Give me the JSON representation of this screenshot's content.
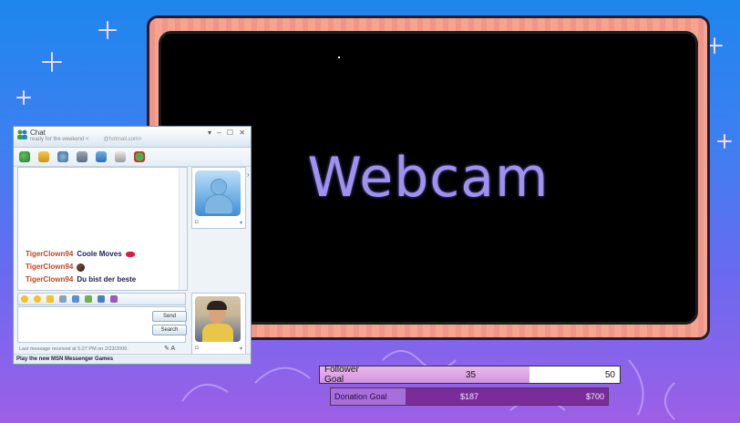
{
  "colors": {
    "accent": "#9f92ee",
    "frame": "#f4a48f",
    "user_name": "#c6431b"
  },
  "webcam": {
    "label": "Webcam"
  },
  "msn": {
    "title": "Chat",
    "subtitle": "ready for the weekend <",
    "email": "@hotmail.com>",
    "window_controls": "▾ – ☐ ✕",
    "toolbar_icons": [
      "invite-icon",
      "files-icon",
      "video-icon",
      "voice-icon",
      "activities-icon",
      "games-icon",
      "block-icon"
    ],
    "messages": [
      {
        "user": "TigerClown94",
        "text": "Coole Moves",
        "emoticon": "kiss-lips-icon"
      },
      {
        "user": "TigerClown94",
        "text": "",
        "emoticon": "bomb-icon"
      },
      {
        "user": "TigerClown94",
        "text": "Du bist der beste",
        "emoticon": ""
      }
    ],
    "send_label": "Send",
    "search_label": "Search",
    "status": "Last message received at 5:27 PM on 2/23/2006.",
    "footer": "Play the new MSN Messenger Games"
  },
  "goals": {
    "follower": {
      "label": "Follower Goal",
      "current": "35",
      "target": "50",
      "progress": 0.7
    },
    "donation": {
      "label": "Donation Goal",
      "current": "$187",
      "target": "$700",
      "progress": 0.27
    }
  }
}
